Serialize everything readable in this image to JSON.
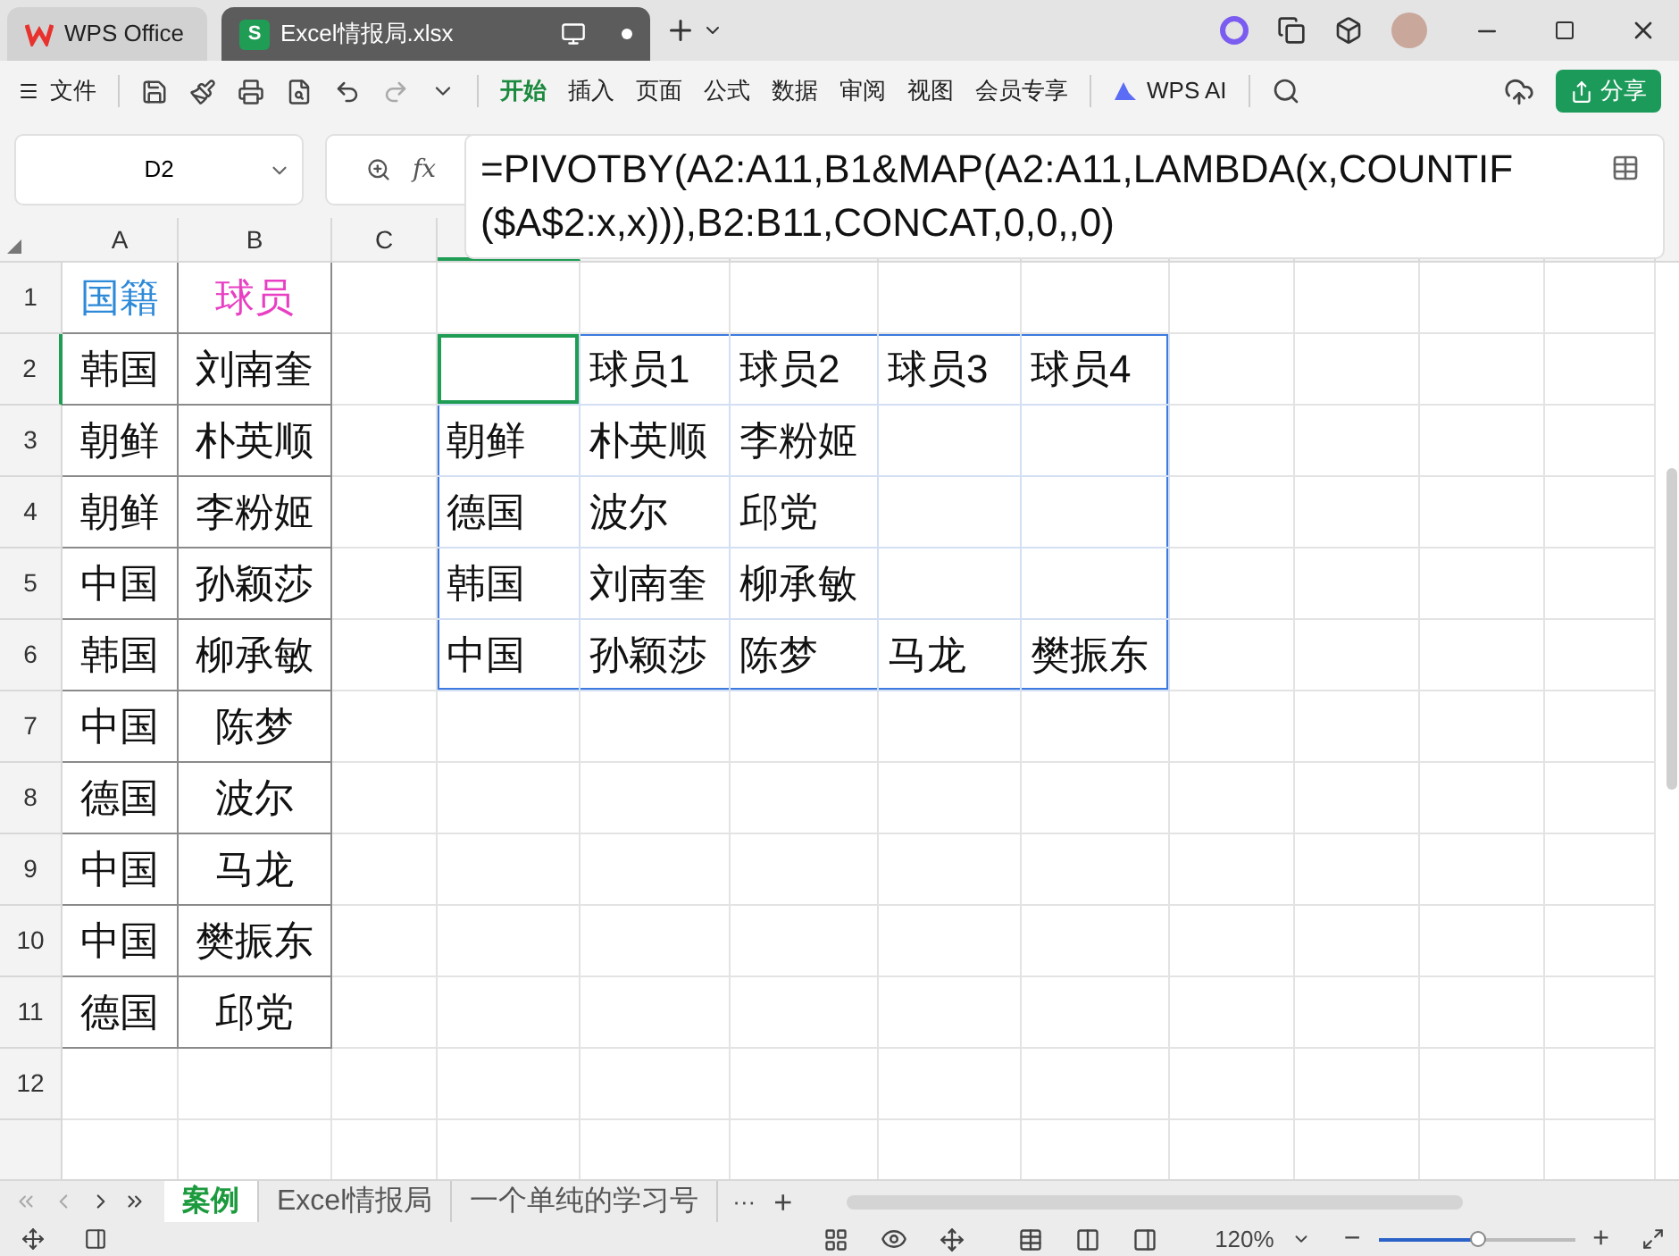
{
  "title_tabs": [
    {
      "label": "WPS Office",
      "kind": "home",
      "selected": false
    },
    {
      "label": "Excel情报局.xlsx",
      "kind": "doc",
      "selected": true
    }
  ],
  "doc_icon_letter": "S",
  "menu": {
    "label": "文件"
  },
  "ribbon_tabs": [
    {
      "label": "开始",
      "selected": true
    },
    {
      "label": "插入",
      "selected": false
    },
    {
      "label": "页面",
      "selected": false
    },
    {
      "label": "公式",
      "selected": false
    },
    {
      "label": "数据",
      "selected": false
    },
    {
      "label": "审阅",
      "selected": false
    },
    {
      "label": "视图",
      "selected": false
    },
    {
      "label": "会员专享",
      "selected": false
    }
  ],
  "ai_button": "WPS AI",
  "share_button": "分享",
  "name_box": "D2",
  "fx_label": "fx",
  "formula": "=PIVOTBY(A2:A11,B1&MAP(A2:A11,LAMBDA(x,COUNTIF($A$2:x,x))),B2:B11,CONCAT,0,0,,0)",
  "column_headers": [
    "A",
    "B",
    "C"
  ],
  "rows": [
    {
      "number": "1",
      "cells": [
        {
          "text": "国籍",
          "color": "#2e8ad8",
          "selected": false
        },
        {
          "text": "球员",
          "color": "#e83fc3",
          "selected": false
        },
        {
          "selected": false
        },
        {
          "selected": false
        },
        {
          "selected": false
        },
        {
          "selected": false
        },
        {
          "selected": false
        },
        {
          "selected": false
        }
      ]
    },
    {
      "number": "2",
      "cells": [
        {
          "text": "韩国",
          "selected": false
        },
        {
          "text": "刘南奎",
          "selected": false
        },
        {
          "selected": false
        },
        {
          "selected": true,
          "spill": true
        },
        {
          "text": "球员1",
          "selected": false,
          "spill": true
        },
        {
          "text": "球员2",
          "selected": false,
          "spill": true
        },
        {
          "text": "球员3",
          "selected": false,
          "spill": true
        },
        {
          "text": "球员4",
          "selected": false,
          "spill": true
        }
      ]
    },
    {
      "number": "3",
      "cells": [
        {
          "text": "朝鲜",
          "selected": false
        },
        {
          "text": "朴英顺",
          "selected": false
        },
        {
          "selected": false
        },
        {
          "text": "朝鲜",
          "selected": false,
          "spill": true
        },
        {
          "text": "朴英顺",
          "selected": false,
          "spill": true
        },
        {
          "text": "李粉姬",
          "selected": false,
          "spill": true
        },
        {
          "selected": false,
          "spill": true
        },
        {
          "selected": false,
          "spill": true
        }
      ]
    },
    {
      "number": "4",
      "cells": [
        {
          "text": "朝鲜",
          "selected": false
        },
        {
          "text": "李粉姬",
          "selected": false
        },
        {
          "selected": false
        },
        {
          "text": "德国",
          "selected": false,
          "spill": true
        },
        {
          "text": "波尔",
          "selected": false,
          "spill": true
        },
        {
          "text": "邱党",
          "selected": false,
          "spill": true
        },
        {
          "selected": false,
          "spill": true
        },
        {
          "selected": false,
          "spill": true
        }
      ]
    },
    {
      "number": "5",
      "cells": [
        {
          "text": "中国",
          "selected": false
        },
        {
          "text": "孙颖莎",
          "selected": false
        },
        {
          "selected": false
        },
        {
          "text": "韩国",
          "selected": false,
          "spill": true
        },
        {
          "text": "刘南奎",
          "selected": false,
          "spill": true
        },
        {
          "text": "柳承敏",
          "selected": false,
          "spill": true
        },
        {
          "selected": false,
          "spill": true
        },
        {
          "selected": false,
          "spill": true
        }
      ]
    },
    {
      "number": "6",
      "cells": [
        {
          "text": "韩国",
          "selected": false
        },
        {
          "text": "柳承敏",
          "selected": false
        },
        {
          "selected": false
        },
        {
          "text": "中国",
          "selected": false,
          "spill": true
        },
        {
          "text": "孙颖莎",
          "selected": false,
          "spill": true
        },
        {
          "text": "陈梦",
          "selected": false,
          "spill": true
        },
        {
          "text": "马龙",
          "selected": false,
          "spill": true
        },
        {
          "text": "樊振东",
          "selected": false,
          "spill": true
        }
      ]
    },
    {
      "number": "7",
      "cells": [
        {
          "text": "中国",
          "selected": false
        },
        {
          "text": "陈梦",
          "selected": false
        }
      ]
    },
    {
      "number": "8",
      "cells": [
        {
          "text": "德国",
          "selected": false
        },
        {
          "text": "波尔",
          "selected": false
        }
      ]
    },
    {
      "number": "9",
      "cells": [
        {
          "text": "中国",
          "selected": false
        },
        {
          "text": "马龙",
          "selected": false
        }
      ]
    },
    {
      "number": "10",
      "cells": [
        {
          "text": "中国",
          "selected": false
        },
        {
          "text": "樊振东",
          "selected": false
        }
      ]
    },
    {
      "number": "11",
      "cells": [
        {
          "text": "德国",
          "selected": false
        },
        {
          "text": "邱党",
          "selected": false
        }
      ]
    },
    {
      "number": "12",
      "cells": []
    }
  ],
  "sheet_tabs": [
    {
      "label": "案例",
      "selected": true
    },
    {
      "label": "Excel情报局",
      "selected": false
    },
    {
      "label": "一个单纯的学习号",
      "selected": false
    }
  ],
  "more_sheets": "···",
  "add_sheet": "+",
  "zoom": {
    "reading": "120%",
    "level": 0.5,
    "minus": "−",
    "plus": "+"
  }
}
